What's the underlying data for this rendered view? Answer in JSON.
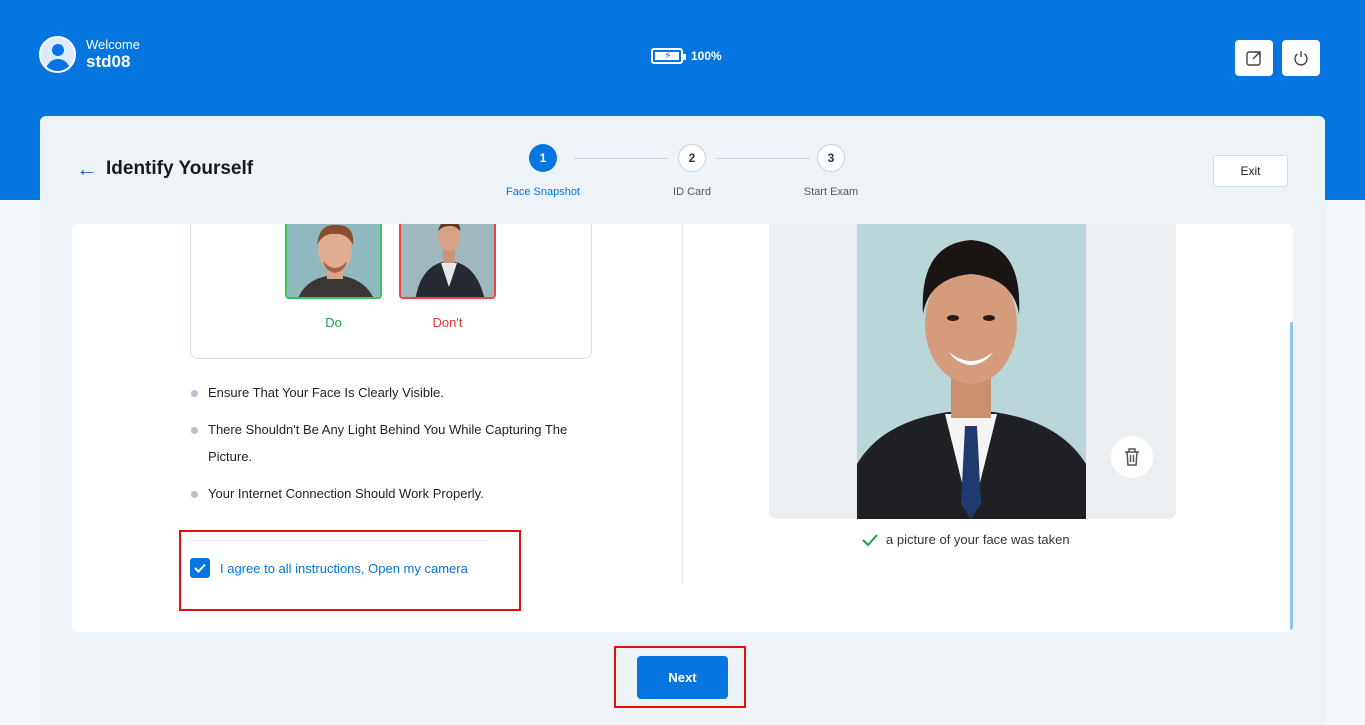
{
  "header": {
    "welcome": "Welcome",
    "username": "std08",
    "battery_level": "100%",
    "battery_fraction": 1.0,
    "external_icon": "external-link-icon",
    "power_icon": "power-icon"
  },
  "page": {
    "title": "Identify Yourself",
    "exit_label": "Exit"
  },
  "steps": [
    {
      "number": "1",
      "label": "Face Snapshot",
      "active": true
    },
    {
      "number": "2",
      "label": "ID Card",
      "active": false
    },
    {
      "number": "3",
      "label": "Start Exam",
      "active": false
    }
  ],
  "examples": {
    "do_label": "Do",
    "dont_label": "Don't"
  },
  "rules": [
    "Ensure That Your Face Is Clearly Visible.",
    "There Shouldn't Be Any Light Behind You While Capturing The Picture.",
    "Your Internet Connection Should Work Properly."
  ],
  "agree": {
    "label": "I agree to all instructions, Open my camera",
    "checked": true
  },
  "capture": {
    "status": "a picture of your face was taken"
  },
  "footer": {
    "next_label": "Next"
  },
  "colors": {
    "brand": "#0575e0",
    "success": "#16a34a",
    "danger": "#e53935",
    "highlight": "#e01010"
  }
}
